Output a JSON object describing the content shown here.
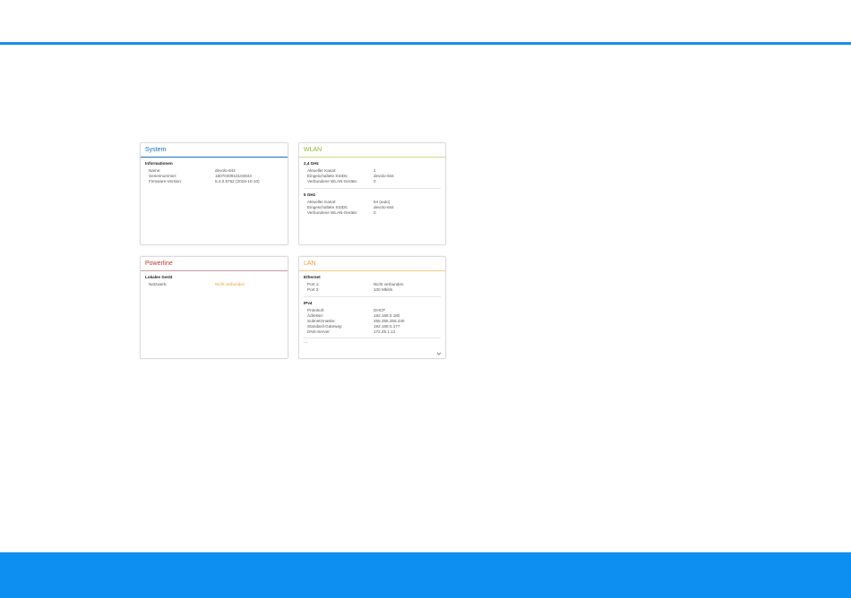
{
  "colors": {
    "accent": "#1a8fe3",
    "system": "#1e6fb0",
    "wlan": "#8fb82b",
    "powerline": "#c0392b",
    "lan": "#f0a030",
    "footer": "#0c8ff0"
  },
  "system": {
    "title": "System",
    "section": "Informationen",
    "rows": [
      {
        "k": "Name:",
        "v": "devolo-844"
      },
      {
        "k": "Seriennummer:",
        "v": "1807040910104844"
      },
      {
        "k": "Firmware-Version:",
        "v": "5.4.0.5762 (2019-10-10)"
      }
    ]
  },
  "wlan": {
    "title": "WLAN",
    "band1": {
      "title": "2,4 GHz",
      "rows": [
        {
          "k": "Aktueller Kanal:",
          "v": "1"
        },
        {
          "k": "Eingeschaltete SSIDs:",
          "v": "devolo-844"
        },
        {
          "k": "Verbundene WLAN-Geräte:",
          "v": "0"
        }
      ]
    },
    "band2": {
      "title": "5 GHz",
      "rows": [
        {
          "k": "Aktueller Kanal:",
          "v": "64 (auto)"
        },
        {
          "k": "Eingeschaltete SSIDs:",
          "v": "devolo-844"
        },
        {
          "k": "Verbundene WLAN-Geräte:",
          "v": "0"
        }
      ]
    }
  },
  "powerline": {
    "title": "Powerline",
    "section": "Lokales Gerät",
    "rows": [
      {
        "k": "Netzwerk:",
        "v": "Nicht verbunden"
      }
    ]
  },
  "lan": {
    "title": "LAN",
    "ethernet": {
      "title": "Ethernet",
      "rows": [
        {
          "k": "Port 1:",
          "v": "Nicht verbunden"
        },
        {
          "k": "Port 2:",
          "v": "100 Mbit/s"
        }
      ]
    },
    "ipv4": {
      "title": "IPv4",
      "rows": [
        {
          "k": "Protokoll:",
          "v": "DHCP"
        },
        {
          "k": "Adresse:",
          "v": "192.168.0.180"
        },
        {
          "k": "Subnetzmaske:",
          "v": "255.255.255.240"
        },
        {
          "k": "Standard-Gateway:",
          "v": "192.168.0.177"
        },
        {
          "k": "DNS-Server:",
          "v": "172.25.1.12"
        }
      ]
    },
    "more": "..."
  }
}
